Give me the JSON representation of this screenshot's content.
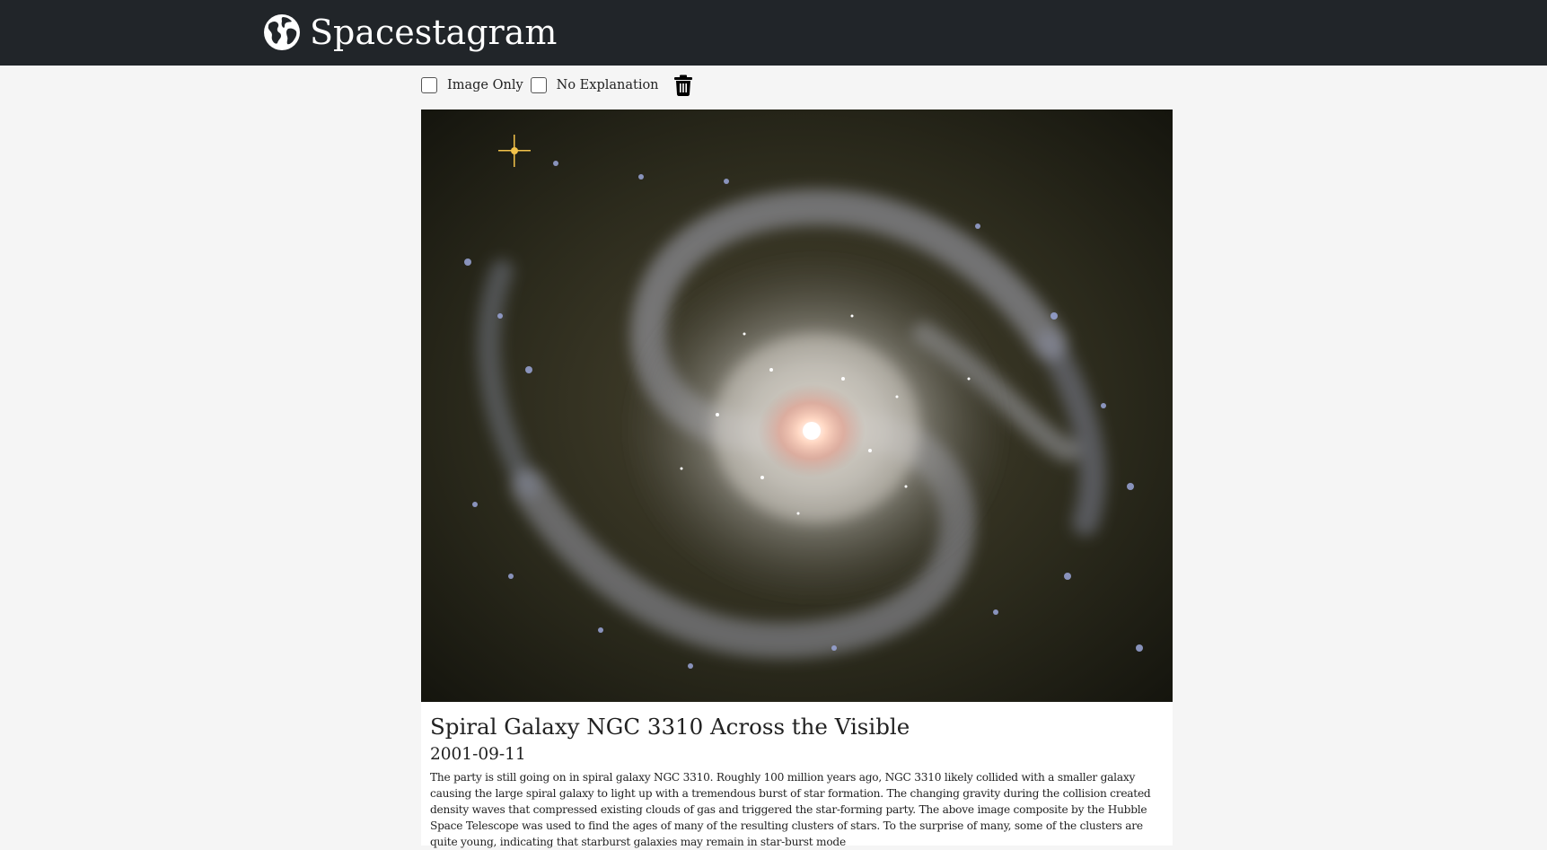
{
  "app": {
    "title": "Spacestagram"
  },
  "icons": {
    "brand": "globe-icon",
    "delete": "trash-icon"
  },
  "colors": {
    "navbar": "#212529",
    "background": "#f5f5f5",
    "card": "#ffffff"
  },
  "filters": [
    {
      "label": "Image Only",
      "checked": false
    },
    {
      "label": "No Explanation",
      "checked": false
    }
  ],
  "post": {
    "title": "Spiral Galaxy NGC 3310 Across the Visible",
    "date": "2001-09-11",
    "explanation": "The party is still going on in spiral galaxy NGC 3310. Roughly 100 million years ago, NGC 3310 likely collided with a smaller galaxy causing the large spiral galaxy to light up with a tremendous burst of star formation. The changing gravity during the collision created density waves that compressed existing clouds of gas and triggered the star-forming party. The above image composite by the Hubble Space Telescope was used to find the ages of many of the resulting clusters of stars. To the surprise of many, some of the clusters are quite young, indicating that starburst galaxies may remain in star-burst mode"
  }
}
